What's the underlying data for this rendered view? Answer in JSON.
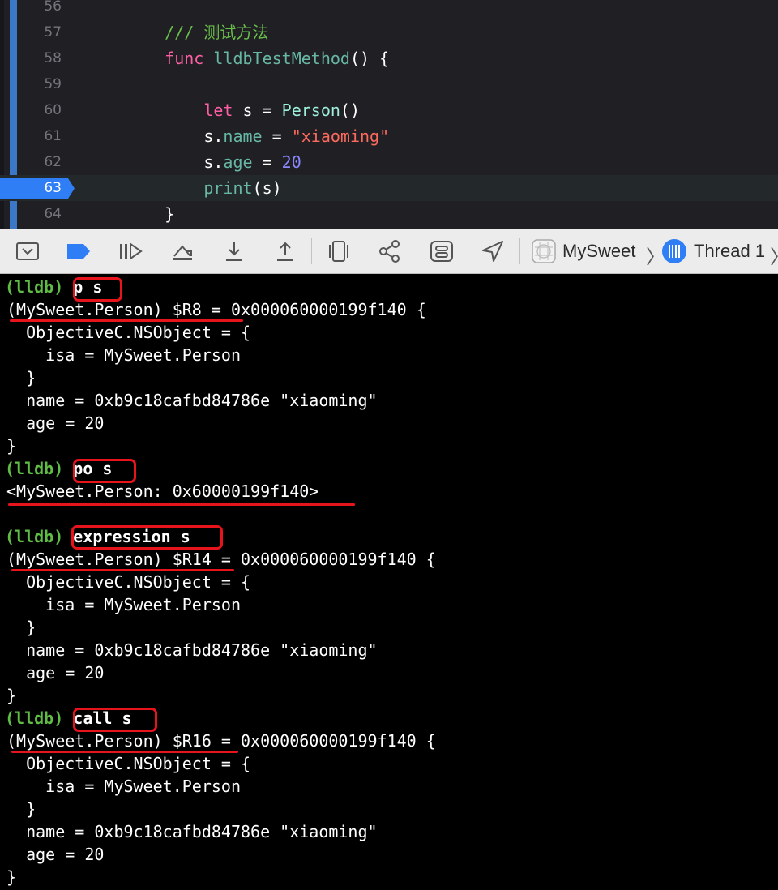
{
  "editor": {
    "lines": [
      {
        "num": "56",
        "parts": []
      },
      {
        "num": "57",
        "parts": [
          {
            "t": "    ",
            "c": ""
          },
          {
            "t": "/// 测试方法",
            "c": "t-comment"
          }
        ]
      },
      {
        "num": "58",
        "parts": [
          {
            "t": "    ",
            "c": ""
          },
          {
            "t": "func",
            "c": "t-kw"
          },
          {
            "t": " ",
            "c": ""
          },
          {
            "t": "lldbTestMethod",
            "c": "t-fn"
          },
          {
            "t": "() {",
            "c": ""
          }
        ]
      },
      {
        "num": "59",
        "parts": []
      },
      {
        "num": "60",
        "parts": [
          {
            "t": "        ",
            "c": ""
          },
          {
            "t": "let",
            "c": "t-kw"
          },
          {
            "t": " s = ",
            "c": ""
          },
          {
            "t": "Person",
            "c": "t-type"
          },
          {
            "t": "()",
            "c": ""
          }
        ]
      },
      {
        "num": "61",
        "parts": [
          {
            "t": "        s.",
            "c": ""
          },
          {
            "t": "name",
            "c": "t-prop"
          },
          {
            "t": " = ",
            "c": ""
          },
          {
            "t": "\"xiaoming\"",
            "c": "t-str"
          }
        ]
      },
      {
        "num": "62",
        "parts": [
          {
            "t": "        s.",
            "c": ""
          },
          {
            "t": "age",
            "c": "t-prop"
          },
          {
            "t": " = ",
            "c": ""
          },
          {
            "t": "20",
            "c": "t-num"
          }
        ]
      },
      {
        "num": "63",
        "current": true,
        "parts": [
          {
            "t": "        ",
            "c": ""
          },
          {
            "t": "print",
            "c": "t-call"
          },
          {
            "t": "(s)",
            "c": ""
          }
        ]
      },
      {
        "num": "64",
        "parts": [
          {
            "t": "    }",
            "c": ""
          }
        ]
      }
    ]
  },
  "toolbar": {
    "buttons": [
      {
        "name": "hide-debug-area-button",
        "icon": "hide-debug-area-icon"
      },
      {
        "name": "breakpoints-toggle-button",
        "icon": "breakpoint-icon"
      },
      {
        "name": "continue-button",
        "icon": "continue-icon"
      },
      {
        "name": "step-over-button",
        "icon": "step-over-icon"
      },
      {
        "name": "step-into-button",
        "icon": "step-into-icon"
      },
      {
        "name": "step-out-button",
        "icon": "step-out-icon"
      },
      {
        "name": "view-hierarchy-button",
        "icon": "view-hierarchy-icon"
      },
      {
        "name": "memory-graph-button",
        "icon": "memory-graph-icon"
      },
      {
        "name": "environment-overrides-button",
        "icon": "environment-overrides-icon"
      },
      {
        "name": "simulate-location-button",
        "icon": "location-icon"
      }
    ],
    "process": "MySweet",
    "thread": "Thread 1"
  },
  "console": {
    "prompt": "(lldb)",
    "lines": [
      {
        "kind": "cmd",
        "text": "p s"
      },
      {
        "kind": "out",
        "text": "(MySweet.Person) $R8 = 0x000060000199f140 {"
      },
      {
        "kind": "out",
        "text": "  ObjectiveC.NSObject = {"
      },
      {
        "kind": "out",
        "text": "    isa = MySweet.Person"
      },
      {
        "kind": "out",
        "text": "  }"
      },
      {
        "kind": "out",
        "text": "  name = 0xb9c18cafbd84786e \"xiaoming\""
      },
      {
        "kind": "out",
        "text": "  age = 20"
      },
      {
        "kind": "out",
        "text": "}"
      },
      {
        "kind": "cmd",
        "text": "po s"
      },
      {
        "kind": "out",
        "text": "<MySweet.Person: 0x60000199f140>"
      },
      {
        "kind": "out",
        "text": ""
      },
      {
        "kind": "cmd",
        "text": "expression s"
      },
      {
        "kind": "out",
        "text": "(MySweet.Person) $R14 = 0x000060000199f140 {"
      },
      {
        "kind": "out",
        "text": "  ObjectiveC.NSObject = {"
      },
      {
        "kind": "out",
        "text": "    isa = MySweet.Person"
      },
      {
        "kind": "out",
        "text": "  }"
      },
      {
        "kind": "out",
        "text": "  name = 0xb9c18cafbd84786e \"xiaoming\""
      },
      {
        "kind": "out",
        "text": "  age = 20"
      },
      {
        "kind": "out",
        "text": "}"
      },
      {
        "kind": "cmd",
        "text": "call s"
      },
      {
        "kind": "out",
        "text": "(MySweet.Person) $R16 = 0x000060000199f140 {"
      },
      {
        "kind": "out",
        "text": "  ObjectiveC.NSObject = {"
      },
      {
        "kind": "out",
        "text": "    isa = MySweet.Person"
      },
      {
        "kind": "out",
        "text": "  }"
      },
      {
        "kind": "out",
        "text": "  name = 0xb9c18cafbd84786e \"xiaoming\""
      },
      {
        "kind": "out",
        "text": "  age = 20"
      },
      {
        "kind": "out",
        "text": "}"
      }
    ]
  },
  "colors": {
    "annotation_red": "#e8141c",
    "lldb_prompt": "#5fbd45",
    "breakpoint_blue": "#2f7ef5"
  }
}
